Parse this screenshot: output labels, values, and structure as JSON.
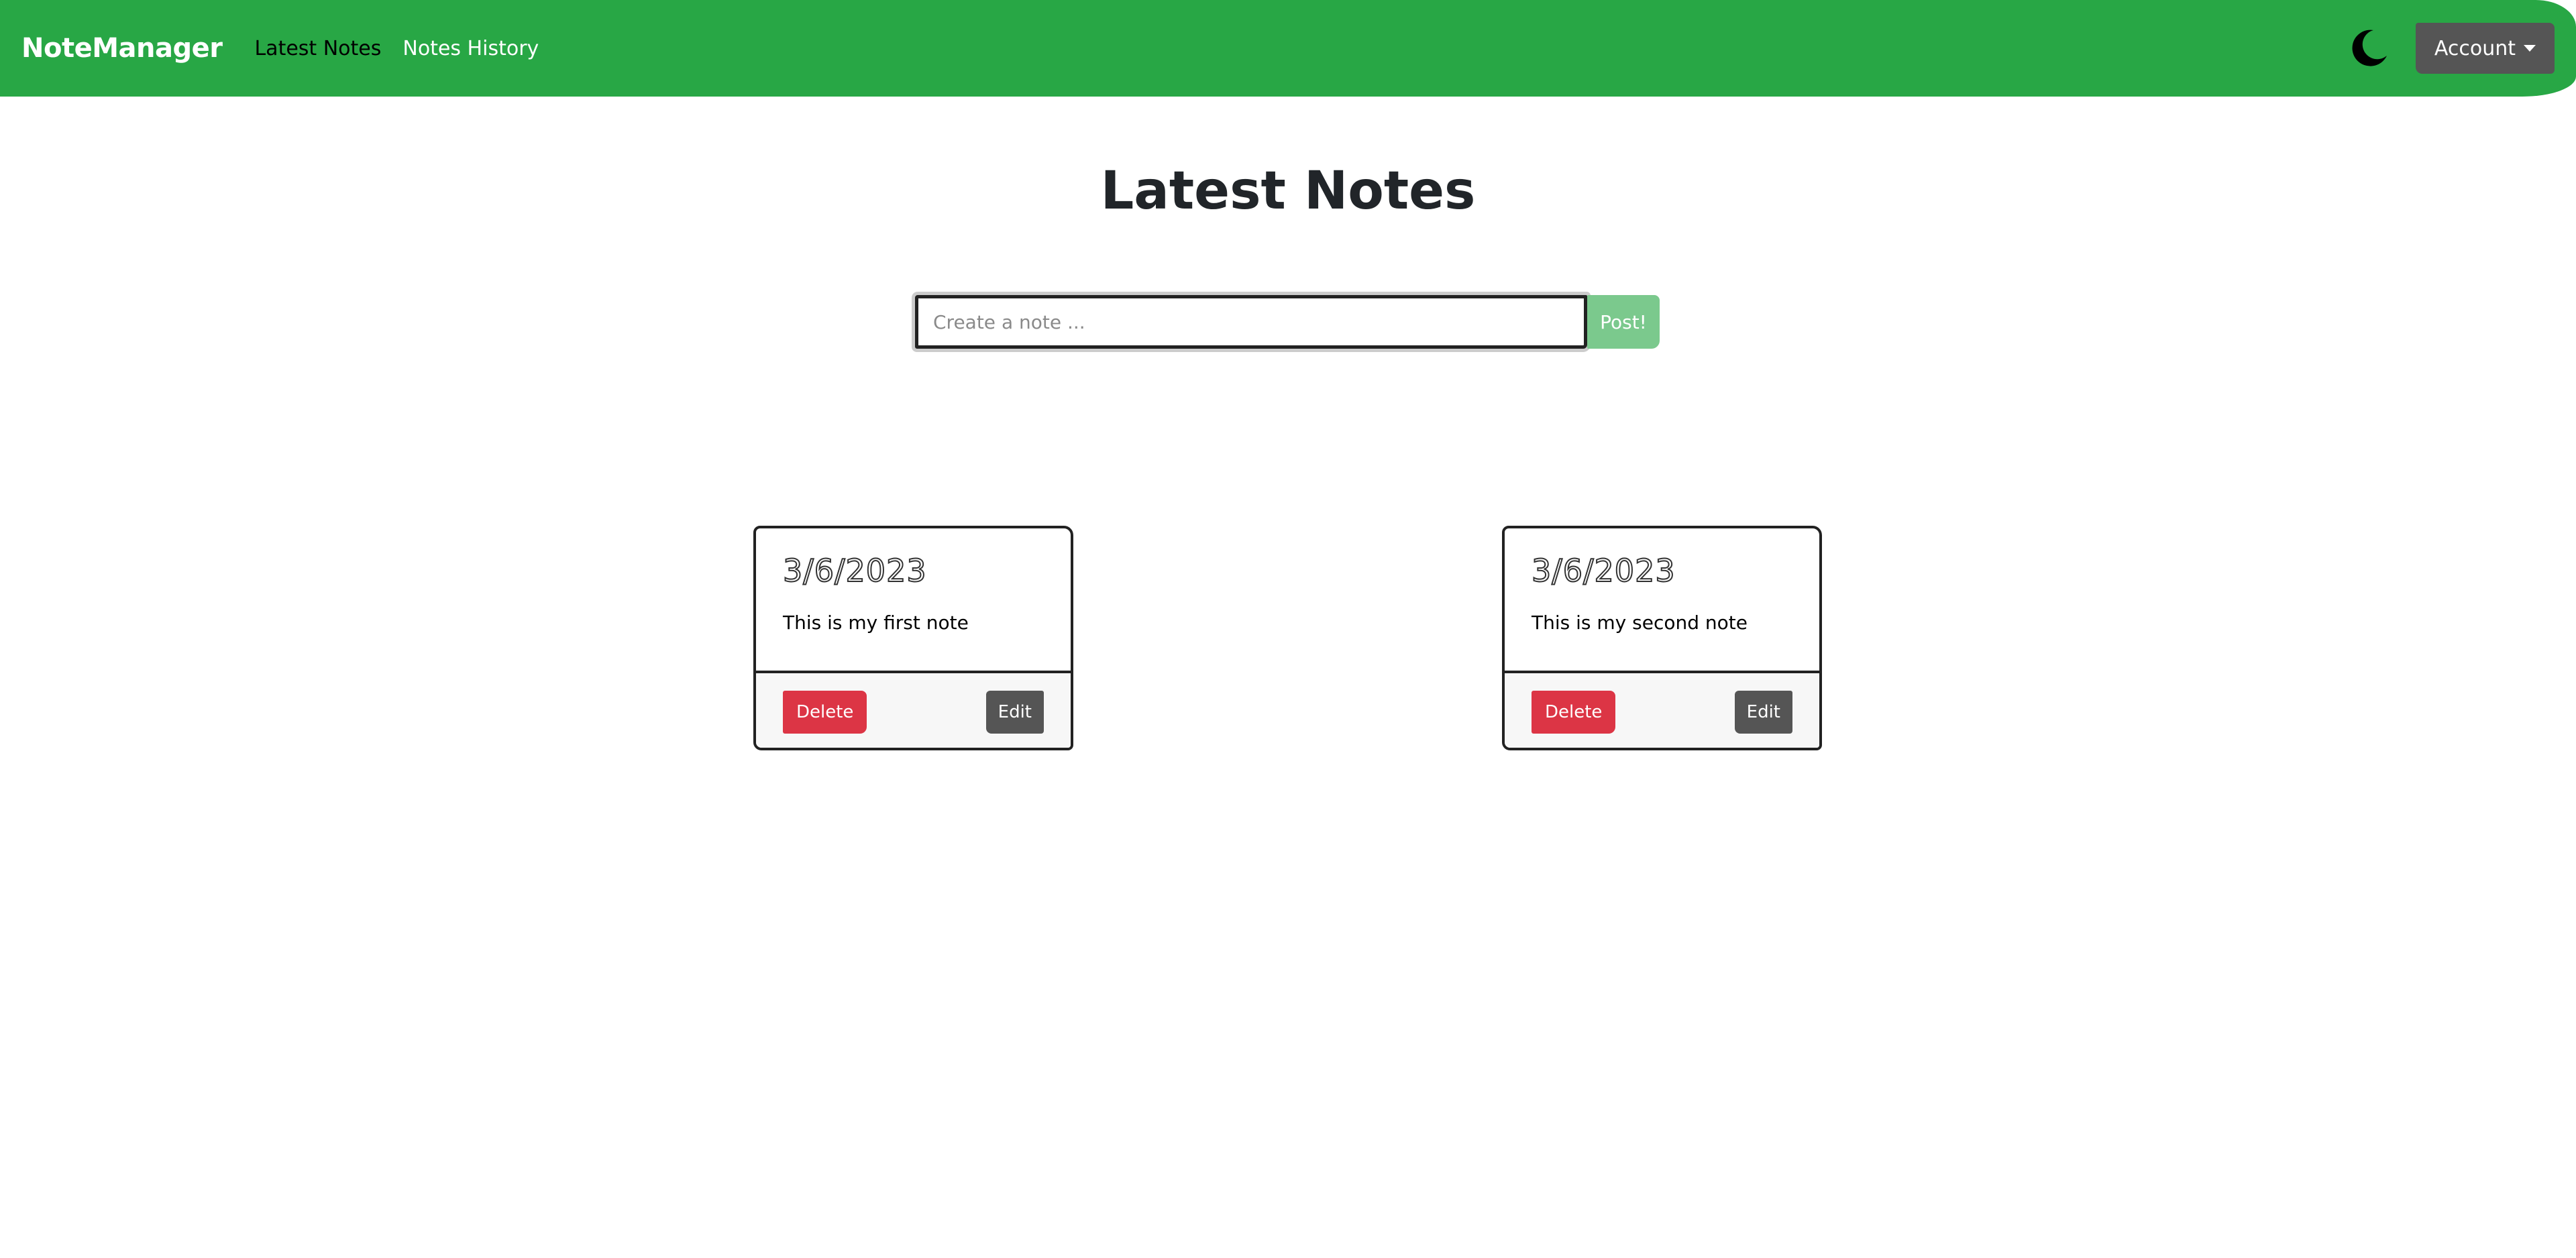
{
  "navbar": {
    "brand": "NoteManager",
    "links": [
      {
        "label": "Latest Notes",
        "active": true
      },
      {
        "label": "Notes History",
        "active": false
      }
    ],
    "theme_toggle_icon": "moon-icon",
    "account_label": "Account"
  },
  "page": {
    "title": "Latest Notes"
  },
  "create_form": {
    "placeholder": "Create a note ...",
    "value": "",
    "post_label": "Post!"
  },
  "notes": [
    {
      "date": "3/6/2023",
      "text": "This is my first note",
      "delete_label": "Delete",
      "edit_label": "Edit"
    },
    {
      "date": "3/6/2023",
      "text": "This is my second note",
      "delete_label": "Delete",
      "edit_label": "Edit"
    }
  ],
  "colors": {
    "navbar_bg": "#28a745",
    "active_link": "#000000",
    "account_bg": "#555555",
    "post_bg": "#7bc98d",
    "delete_bg": "#dc3545",
    "edit_bg": "#555555"
  }
}
